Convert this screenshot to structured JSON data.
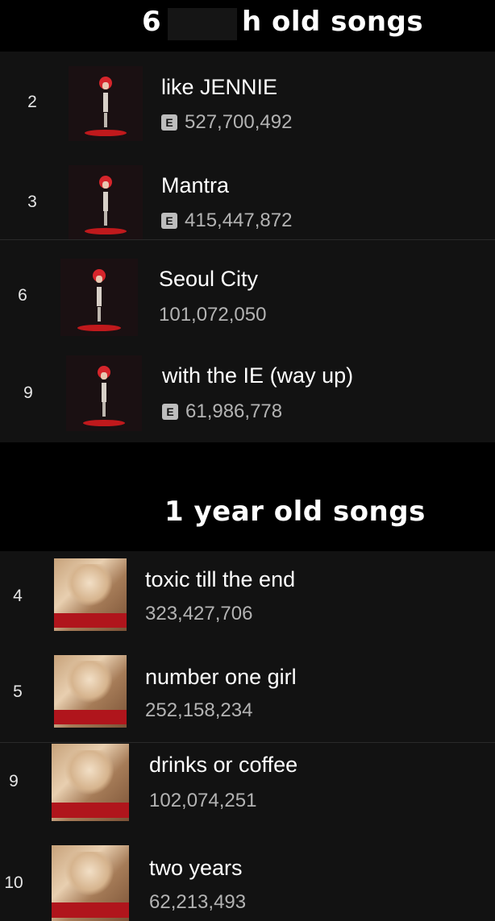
{
  "sections": [
    {
      "title_left": "6",
      "title_right": "h old songs",
      "songs": [
        {
          "rank": "2",
          "title": "like JENNIE",
          "explicit": true,
          "explicit_label": "E",
          "streams": "527,700,492"
        },
        {
          "rank": "3",
          "title": "Mantra",
          "explicit": true,
          "explicit_label": "E",
          "streams": "415,447,872"
        },
        {
          "rank": "6",
          "title": "Seoul City",
          "explicit": false,
          "explicit_label": "",
          "streams": "101,072,050"
        },
        {
          "rank": "9",
          "title": "with the IE (way up)",
          "explicit": true,
          "explicit_label": "E",
          "streams": "61,986,778"
        }
      ]
    },
    {
      "title": "1 year old songs",
      "songs": [
        {
          "rank": "4",
          "title": "toxic till the end",
          "explicit": false,
          "streams": "323,427,706"
        },
        {
          "rank": "5",
          "title": "number one girl",
          "explicit": false,
          "streams": "252,158,234"
        },
        {
          "rank": "9",
          "title": "drinks or coffee",
          "explicit": false,
          "streams": "102,074,251"
        },
        {
          "rank": "10",
          "title": "two years",
          "explicit": false,
          "streams": "62,213,493"
        }
      ]
    }
  ],
  "colors": {
    "background": "#000000",
    "panel": "#121212",
    "text": "#ffffff",
    "subtext": "#b3b3b3",
    "explicit_badge": "#bdbdbd",
    "album_red": "#c0191c"
  },
  "icons": {
    "album_art_1": "album-cover-red-figure",
    "album_art_2": "album-cover-blonde"
  }
}
